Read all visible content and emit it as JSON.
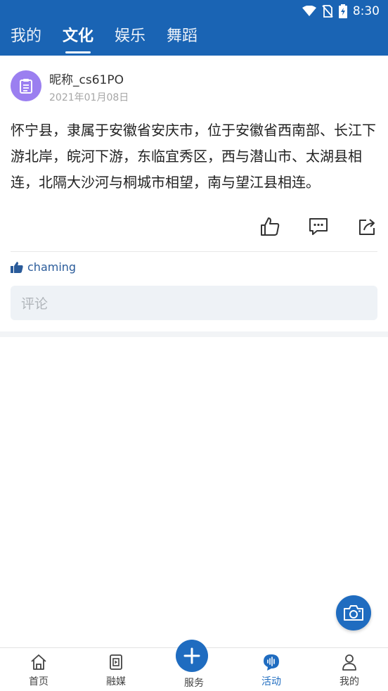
{
  "status_bar": {
    "time": "8:30",
    "icons": [
      "wifi-icon",
      "no-sim-icon",
      "battery-charging-icon"
    ]
  },
  "tabs": [
    {
      "label": "我的",
      "active": false
    },
    {
      "label": "文化",
      "active": true
    },
    {
      "label": "娱乐",
      "active": false
    },
    {
      "label": "舞蹈",
      "active": false
    }
  ],
  "post": {
    "avatar_icon": "clipboard-icon",
    "nickname": "昵称_cs61PO",
    "date": "2021年01月08日",
    "content": "怀宁县，隶属于安徽省安庆市，位于安徽省西南部、长江下游北岸，皖河下游，东临宜秀区，西与潜山市、太湖县相连，北隔大沙河与桐城市相望，南与望江县相连。",
    "actions": [
      "thumbs-up-icon",
      "comment-icon",
      "share-icon"
    ],
    "likes": {
      "icon": "thumbs-up-filled-icon",
      "names": "chaming"
    },
    "comment_placeholder": "评论"
  },
  "camera_button_icon": "camera-icon",
  "bottom_nav": [
    {
      "label": "首页",
      "icon": "home-icon",
      "active": false
    },
    {
      "label": "融媒",
      "icon": "media-icon",
      "active": false
    },
    {
      "label": "服务",
      "icon": "plus-icon",
      "active": false
    },
    {
      "label": "活动",
      "icon": "activity-icon",
      "active": true
    },
    {
      "label": "我的",
      "icon": "user-icon",
      "active": false
    }
  ],
  "colors": {
    "primary": "#1a64b4",
    "accent": "#1f6cc0",
    "avatar": "#9b7ff0"
  }
}
